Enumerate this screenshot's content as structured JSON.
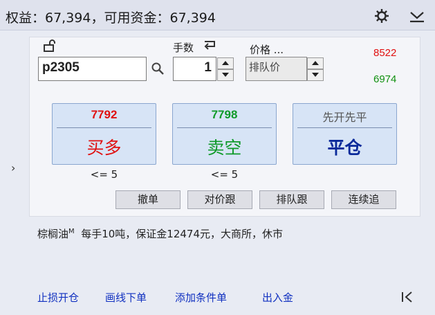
{
  "header": {
    "title": "权益：67,394，可用资金：67,394",
    "icons": [
      "gear-icon",
      "collapse-icon"
    ]
  },
  "order": {
    "symbol": "p2305",
    "qty_label": "手数",
    "qty_value": "1",
    "price_label": "价格 ...",
    "price_value": "排队价",
    "upper_price": "8522",
    "lower_price": "6974"
  },
  "buttons": {
    "buy": {
      "price": "7792",
      "label": "买多",
      "limit": "<= 5"
    },
    "sell": {
      "price": "7798",
      "label": "卖空",
      "limit": "<= 5"
    },
    "close": {
      "top": "先开先平",
      "label": "平仓"
    }
  },
  "actions": [
    "撤单",
    "对价跟",
    "排队跟",
    "连续追"
  ],
  "info": {
    "name": "棕榈油",
    "sup": "M",
    "detail": "每手10吨，保证金12474元，大商所，休市"
  },
  "links": [
    "止损开仓",
    "画线下单",
    "添加条件单",
    "出入金"
  ],
  "colors": {
    "buy": "#e01010",
    "sell": "#0f9a2a",
    "close": "#0a2a9a",
    "link": "#1030c0"
  }
}
